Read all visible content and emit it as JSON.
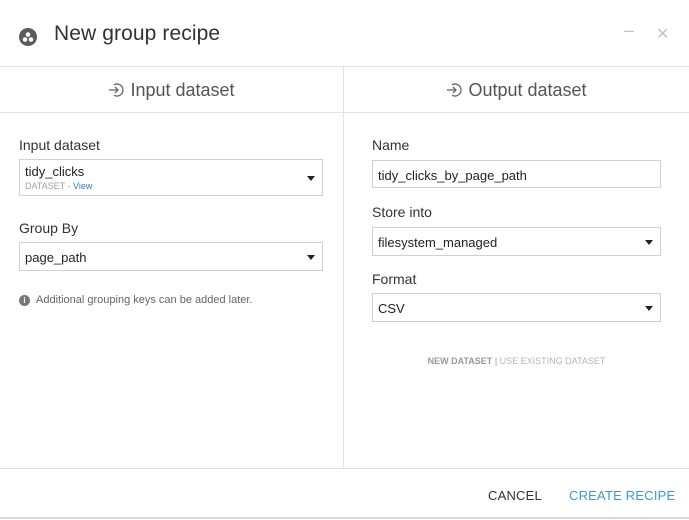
{
  "header": {
    "title": "New group recipe",
    "minimize_glyph": "–",
    "close_glyph": "✕"
  },
  "input_column": {
    "heading": "Input dataset",
    "input_dataset_label": "Input dataset",
    "input_dataset_value": "tidy_clicks",
    "input_dataset_type": "DATASET",
    "input_dataset_sep": " - ",
    "input_dataset_view_link": "View",
    "group_by_label": "Group By",
    "group_by_value": "page_path",
    "info_text": "Additional grouping keys can be added later.",
    "info_icon_glyph": "i"
  },
  "output_column": {
    "heading": "Output dataset",
    "name_label": "Name",
    "name_value": "tidy_clicks_by_page_path",
    "store_into_label": "Store into",
    "store_into_value": "filesystem_managed",
    "format_label": "Format",
    "format_value": "CSV",
    "new_dataset_link": "NEW DATASET",
    "link_separator": "|",
    "use_existing_link": "USE EXISTING DATASET"
  },
  "footer": {
    "cancel_label": "CANCEL",
    "create_label": "CREATE RECIPE"
  },
  "colors": {
    "accent": "#3d9ad8",
    "link": "#2d7fc1",
    "border": "#d0d0d0",
    "divider": "#e3e3e3"
  },
  "icons": {
    "header": "group-recipe-icon",
    "column_heading": "dataset-arrow-icon",
    "info": "info-icon"
  }
}
